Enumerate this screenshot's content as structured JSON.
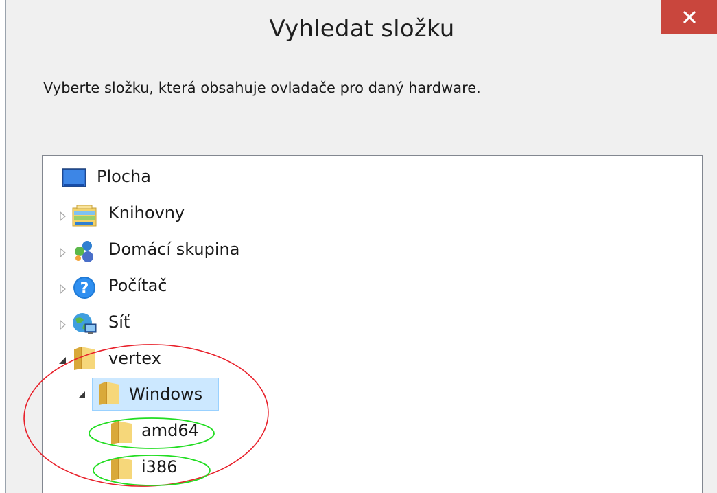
{
  "dialog": {
    "title": "Vyhledat složku",
    "close_glyph": "✕",
    "prompt": "Vyberte složku, která obsahuje ovladače pro daný hardware."
  },
  "tree": {
    "items": [
      {
        "label": "Plocha",
        "icon": "desktop-icon",
        "expander": "none"
      },
      {
        "label": "Knihovny",
        "icon": "libraries-icon",
        "expander": "collapsed"
      },
      {
        "label": "Domácí skupina",
        "icon": "homegroup-icon",
        "expander": "collapsed"
      },
      {
        "label": "Počítač",
        "icon": "help-icon",
        "expander": "collapsed"
      },
      {
        "label": "Síť",
        "icon": "network-icon",
        "expander": "collapsed"
      },
      {
        "label": "vertex",
        "icon": "folder-icon",
        "expander": "expanded"
      },
      {
        "label": "Windows",
        "icon": "folder-icon",
        "expander": "expanded",
        "selected": true
      },
      {
        "label": "amd64",
        "icon": "folder-icon",
        "expander": "none"
      },
      {
        "label": "i386",
        "icon": "folder-icon",
        "expander": "none"
      }
    ]
  },
  "colors": {
    "close_button": "#c9463d",
    "selection": "#cce8ff",
    "annotation_red": "#e8202a",
    "annotation_green": "#22dd22"
  }
}
